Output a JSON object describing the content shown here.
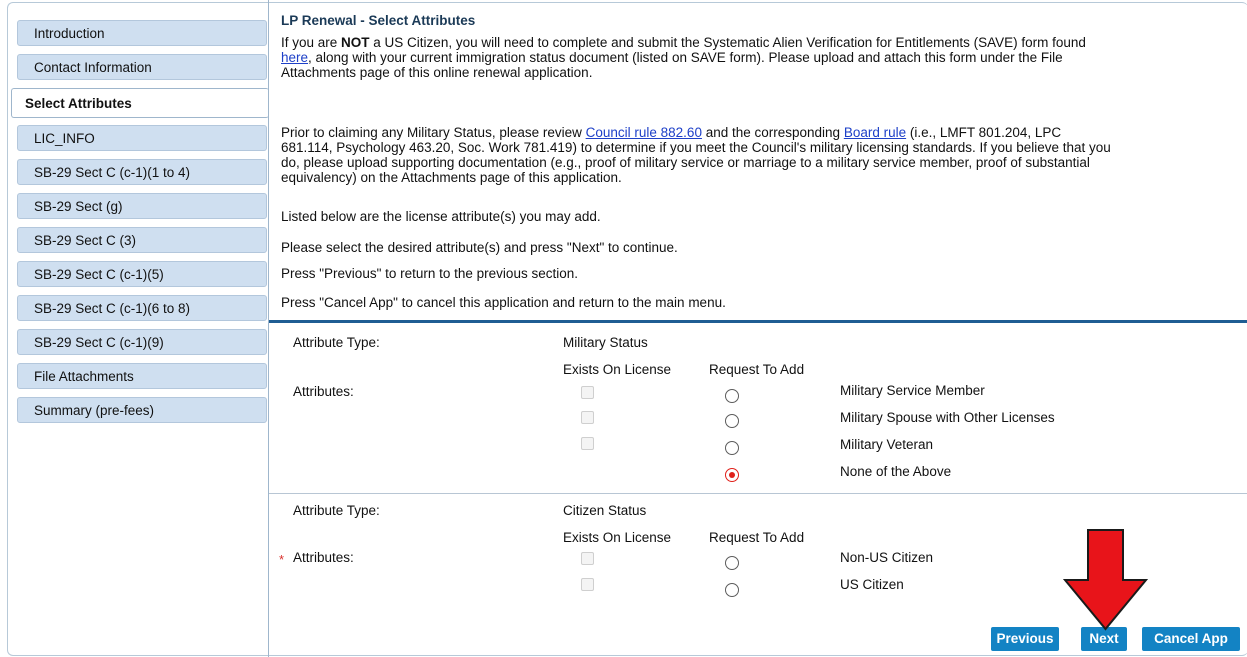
{
  "sidebar": {
    "items": [
      {
        "label": "Introduction"
      },
      {
        "label": "Contact Information"
      },
      {
        "label": "Select Attributes"
      },
      {
        "label": "LIC_INFO"
      },
      {
        "label": "SB-29 Sect C (c-1)(1 to 4)"
      },
      {
        "label": "SB-29 Sect (g)"
      },
      {
        "label": "SB-29 Sect C (3)"
      },
      {
        "label": "SB-29 Sect C (c-1)(5)"
      },
      {
        "label": "SB-29 Sect C (c-1)(6 to 8)"
      },
      {
        "label": "SB-29 Sect C (c-1)(9)"
      },
      {
        "label": "File Attachments"
      },
      {
        "label": "Summary (pre-fees)"
      }
    ]
  },
  "main": {
    "title": "LP Renewal - Select Attributes",
    "save": {
      "p1": "If you are ",
      "bold": "NOT",
      "p2": " a US Citizen, you will need to complete and submit the Systematic Alien Verification for Entitlements (SAVE) form found",
      "link": "here",
      "p3": ", along with your current immigration status document (listed on SAVE form). Please upload and attach this form under the File",
      "p4": "Attachments page of this online renewal application."
    },
    "military_note": {
      "p1": "Prior to claiming any Military Status, please review ",
      "link1": "Council rule 882.60",
      "p2": " and the corresponding ",
      "link2": "Board rule",
      "p3": " (i.e., LMFT 801.204, LPC",
      "p4": "681.114, Psychology 463.20, Soc. Work 781.419) to determine if you meet the Council's military licensing standards. If you believe that you",
      "p5": "do, please upload supporting documentation (e.g., proof of military service or marriage to a military service member, proof of substantial",
      "p6": "equivalency) on the Attachments page of this application."
    },
    "instructions": [
      "Listed below are the license attribute(s) you may add.",
      "Please select the desired attribute(s) and press \"Next\" to continue.",
      "Press \"Previous\" to return to the previous section.",
      "Press \"Cancel App\" to cancel this application and return to the main menu."
    ],
    "sections": [
      {
        "type_label": "Attribute Type:",
        "type_value": "Military Status",
        "col_exists": "Exists On License",
        "col_request": "Request To Add",
        "attr_label": "Attributes:",
        "options": [
          {
            "label": "Military Service Member",
            "selected": false
          },
          {
            "label": "Military Spouse with Other Licenses",
            "selected": false
          },
          {
            "label": "Military Veteran",
            "selected": false
          },
          {
            "label": "None of the Above",
            "selected": true
          }
        ]
      },
      {
        "type_label": "Attribute Type:",
        "type_value": "Citizen Status",
        "col_exists": "Exists On License",
        "col_request": "Request To Add",
        "required_mark": "*",
        "attr_label": "Attributes:",
        "options": [
          {
            "label": "Non-US Citizen",
            "selected": false
          },
          {
            "label": "US Citizen",
            "selected": false
          }
        ]
      }
    ],
    "buttons": {
      "previous": "Previous",
      "next": "Next",
      "cancel": "Cancel App"
    }
  },
  "colors": {
    "button": "#1383c4",
    "sidebar_tab": "#cfdff0",
    "title": "#1b3a57",
    "link": "#1e40c8",
    "selected_radio": "#e0201a",
    "annotation_arrow": "#e8141a"
  },
  "annotation": {
    "icon": "down-arrow-icon",
    "target": "next-button"
  }
}
